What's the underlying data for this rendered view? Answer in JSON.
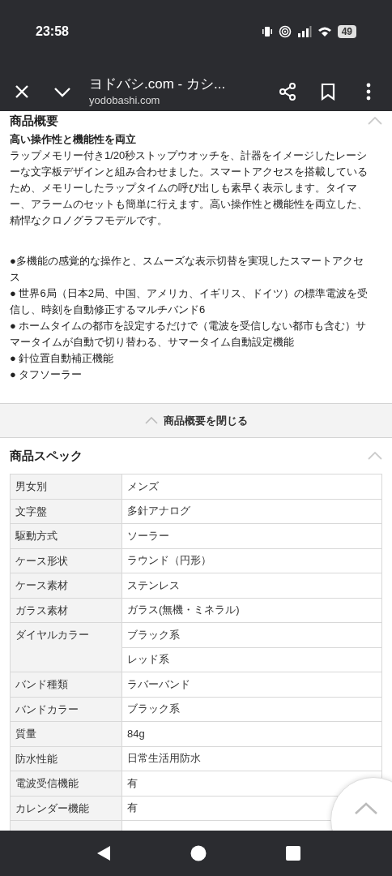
{
  "status_bar": {
    "time": "23:58",
    "battery": "49"
  },
  "toolbar": {
    "title": "ヨドバシ.com - カシ...",
    "url": "yodobashi.com"
  },
  "overview": {
    "heading": "商品概要",
    "expanded": true,
    "subtitle": "高い操作性と機能性を両立",
    "paragraph": "ラップメモリー付き1/20秒ストップウオッチを、計器をイメージしたレーシーな文字板デザインと組み合わせました。スマートアクセスを搭載しているため、メモリーしたラップタイムの呼び出しも素早く表示します。タイマー、アラームのセットも簡単に行えます。高い操作性と機能性を両立した、精悍なクロノグラフモデルです。",
    "bullets": [
      "●多機能の感覚的な操作と、スムーズな表示切替を実現したスマートアクセス",
      "● 世界6局（日本2局、中国、アメリカ、イギリス、ドイツ）の標準電波を受信し、時刻を自動修正するマルチバンド6",
      "● ホームタイムの都市を設定するだけで（電波を受信しない都市も含む）サマータイムが自動で切り替わる、サマータイム自動設定機能",
      "● 針位置自動補正機能",
      "● タフソーラー"
    ],
    "close_label": "商品概要を閉じる"
  },
  "spec": {
    "heading": "商品スペック",
    "expanded": true,
    "rows": [
      {
        "label": "男女別",
        "values": [
          "メンズ"
        ]
      },
      {
        "label": "文字盤",
        "values": [
          "多針アナログ"
        ]
      },
      {
        "label": "駆動方式",
        "values": [
          "ソーラー"
        ]
      },
      {
        "label": "ケース形状",
        "values": [
          "ラウンド（円形）"
        ]
      },
      {
        "label": "ケース素材",
        "values": [
          "ステンレス"
        ]
      },
      {
        "label": "ガラス素材",
        "values": [
          "ガラス(無機・ミネラル)"
        ]
      },
      {
        "label": "ダイヤルカラー",
        "values": [
          "ブラック系",
          "レッド系"
        ]
      },
      {
        "label": "バンド種類",
        "values": [
          "ラバーバンド"
        ]
      },
      {
        "label": "バンドカラー",
        "values": [
          "ブラック系"
        ]
      },
      {
        "label": "質量",
        "values": [
          "84g"
        ]
      },
      {
        "label": "防水性能",
        "values": [
          "日常生活用防水"
        ]
      },
      {
        "label": "電波受信機能",
        "values": [
          "有"
        ]
      },
      {
        "label": "カレンダー機能",
        "values": [
          "有"
        ]
      }
    ]
  }
}
